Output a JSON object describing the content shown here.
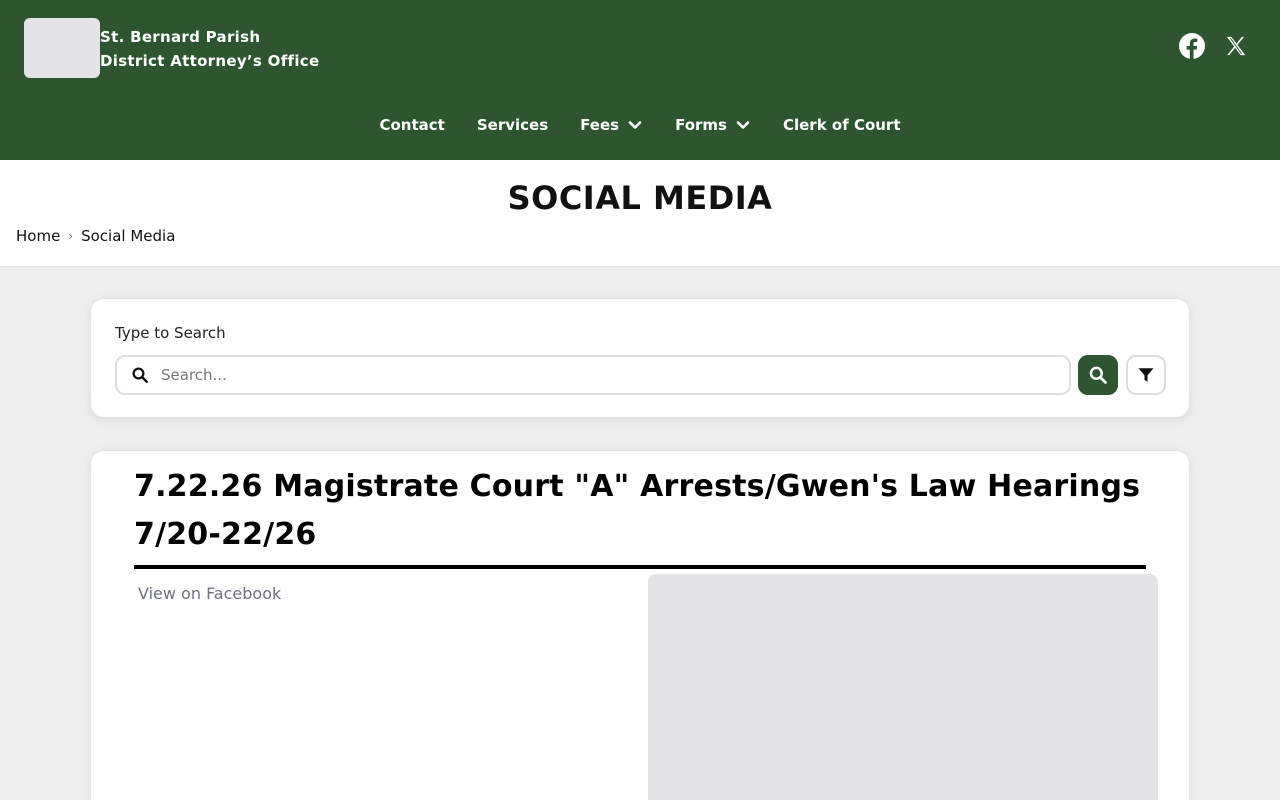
{
  "header": {
    "brand_line1": "St. Bernard Parish",
    "brand_line2": "District Attorney’s Office",
    "bg_color": "#2c5530",
    "social": [
      {
        "name": "facebook-icon"
      },
      {
        "name": "x-icon"
      }
    ]
  },
  "nav": {
    "items": [
      {
        "label": "Contact",
        "has_dropdown": false
      },
      {
        "label": "Services",
        "has_dropdown": false
      },
      {
        "label": "Fees",
        "has_dropdown": true
      },
      {
        "label": "Forms",
        "has_dropdown": true
      },
      {
        "label": "Clerk of Court",
        "has_dropdown": false
      }
    ]
  },
  "page": {
    "title": "SOCIAL MEDIA",
    "breadcrumb": [
      "Home",
      "Social Media"
    ]
  },
  "search": {
    "label": "Type to Search",
    "placeholder": "Search...",
    "value": ""
  },
  "post": {
    "title": "7.22.26 Magistrate Court \"A\" Arrests/Gwen's Law Hearings 7/20-22/26",
    "link_label": "View on Facebook"
  }
}
